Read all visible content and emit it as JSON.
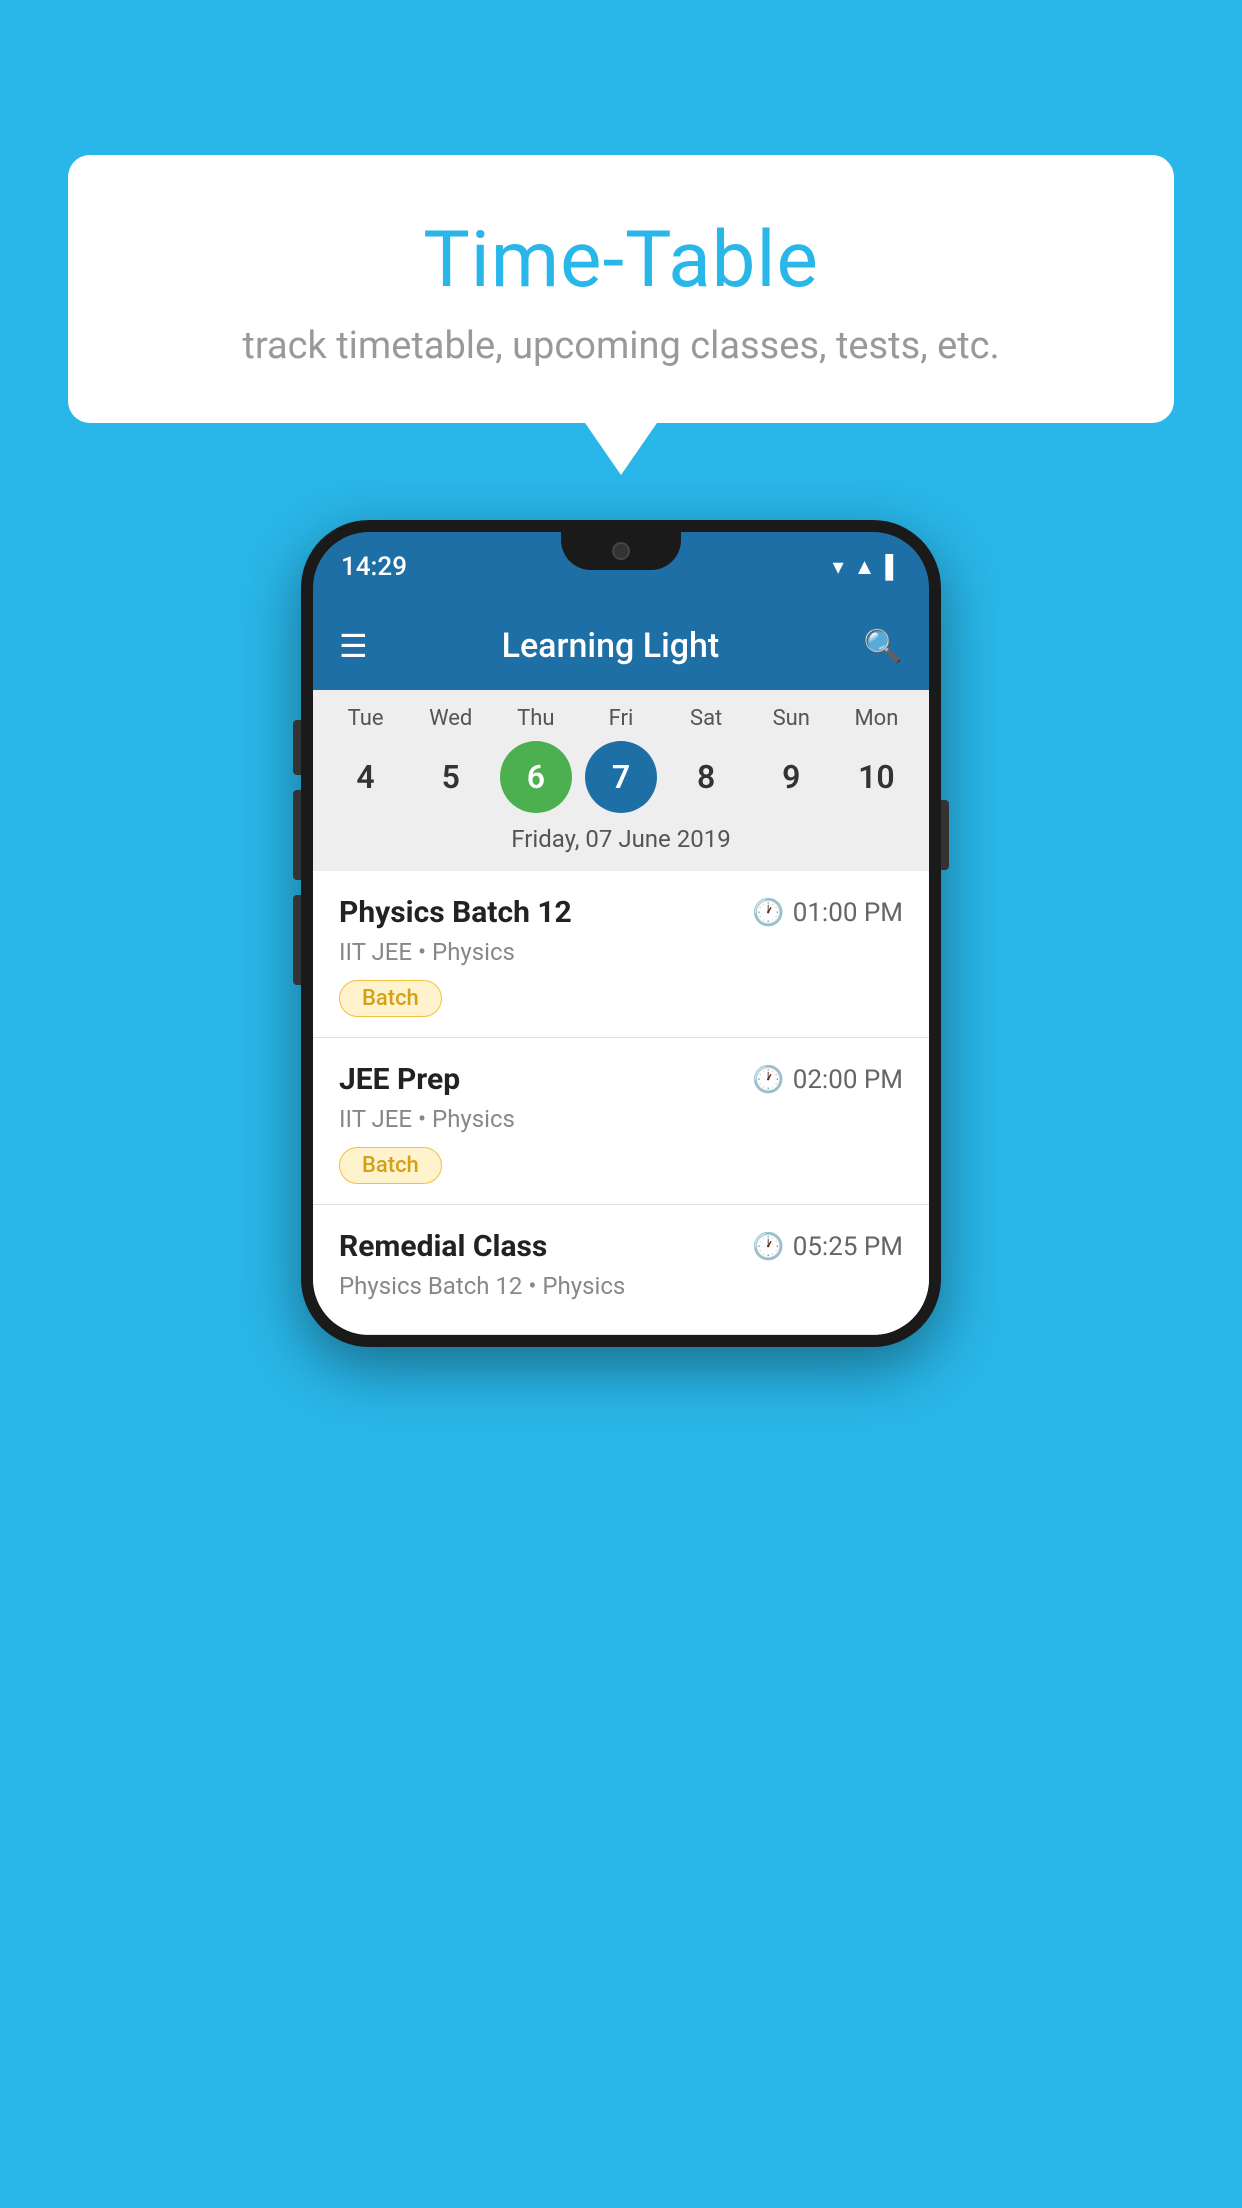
{
  "background_color": "#29B6E8",
  "bubble": {
    "title": "Time-Table",
    "subtitle": "track timetable, upcoming classes, tests, etc."
  },
  "phone": {
    "status_bar": {
      "time": "14:29"
    },
    "app_bar": {
      "title": "Learning Light"
    },
    "calendar": {
      "days": [
        "Tue",
        "Wed",
        "Thu",
        "Fri",
        "Sat",
        "Sun",
        "Mon"
      ],
      "dates": [
        "4",
        "5",
        "6",
        "7",
        "8",
        "9",
        "10"
      ],
      "today_index": 2,
      "selected_index": 3,
      "selected_date_label": "Friday, 07 June 2019"
    },
    "classes": [
      {
        "name": "Physics Batch 12",
        "time": "01:00 PM",
        "meta": "IIT JEE • Physics",
        "badge": "Batch"
      },
      {
        "name": "JEE Prep",
        "time": "02:00 PM",
        "meta": "IIT JEE • Physics",
        "badge": "Batch"
      },
      {
        "name": "Remedial Class",
        "time": "05:25 PM",
        "meta": "Physics Batch 12 • Physics",
        "badge": null
      }
    ]
  }
}
